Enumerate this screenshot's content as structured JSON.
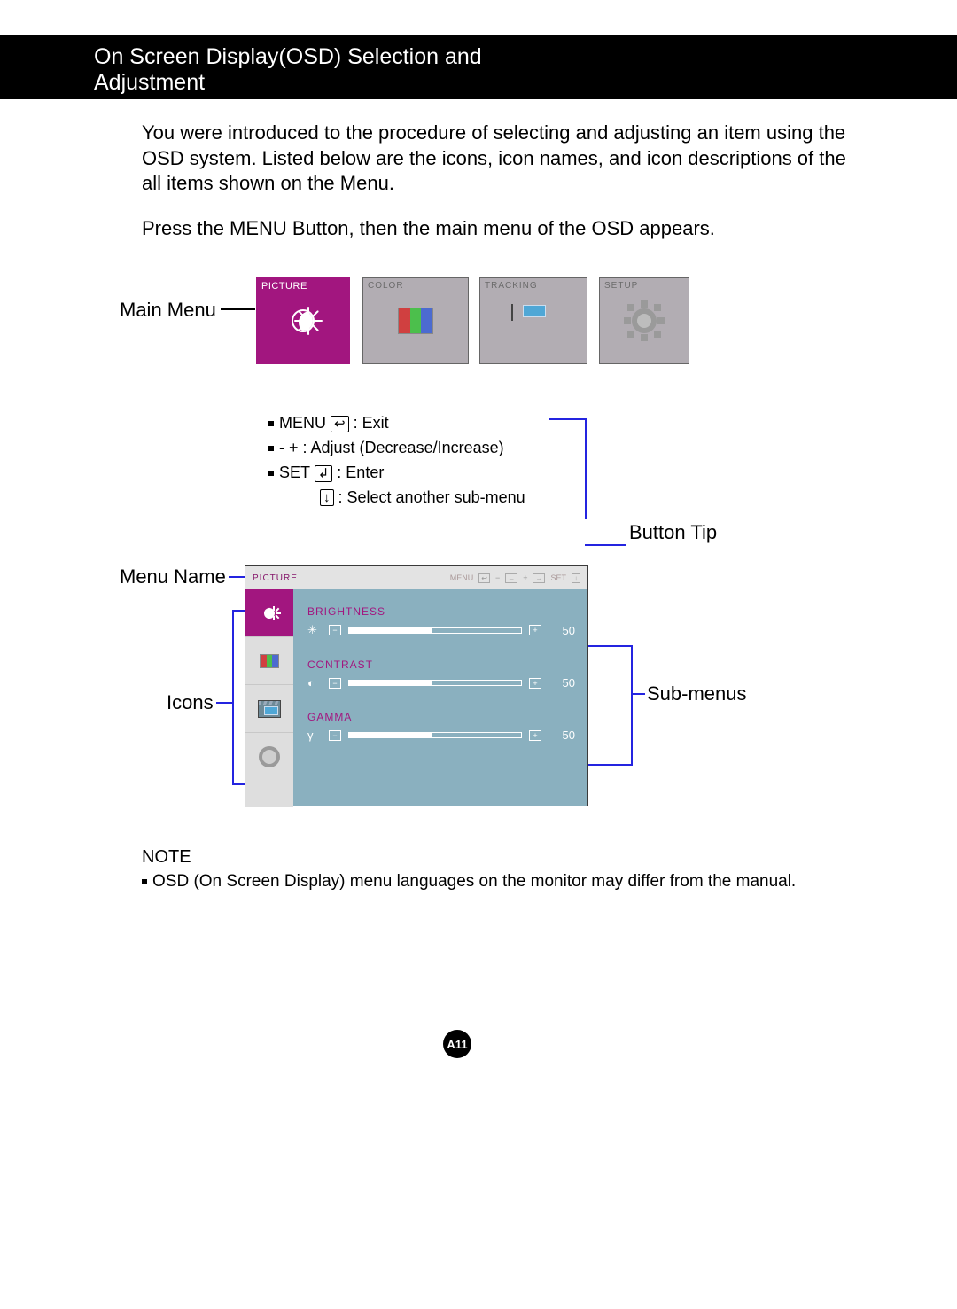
{
  "title": "On Screen Display(OSD) Selection and Adjustment",
  "intro1": "You were introduced to the procedure of selecting and adjusting an item using the OSD system.  Listed below are the icons, icon names, and icon descriptions of the all items shown on the Menu.",
  "intro2": "Press the MENU Button, then the main menu of the OSD appears.",
  "labels": {
    "main_menu": "Main Menu",
    "button_tip": "Button Tip",
    "menu_name": "Menu Name",
    "icons": "Icons",
    "sub_menus": "Sub-menus"
  },
  "tabs": {
    "picture": "PICTURE",
    "color": "COLOR",
    "tracking": "TRACKING",
    "setup": "SETUP"
  },
  "instructions": {
    "menu": "MENU",
    "menu_desc": ": Exit",
    "adjust": "-  + : Adjust (Decrease/Increase)",
    "set": "SET",
    "set_desc": ": Enter",
    "down_desc": ": Select another sub-menu"
  },
  "osd": {
    "title": "PICTURE",
    "hdr_menu": "MENU",
    "hdr_set": "SET",
    "groups": [
      {
        "name": "BRIGHTNESS",
        "icon": "✳",
        "value": 50,
        "pct": 48
      },
      {
        "name": "CONTRAST",
        "icon": "◐",
        "value": 50,
        "pct": 48
      },
      {
        "name": "GAMMA",
        "icon": "γ",
        "value": 50,
        "pct": 48
      }
    ]
  },
  "note_title": "NOTE",
  "note_body": "OSD (On Screen Display) menu languages on the monitor may differ from the manual.",
  "page_number": "A11"
}
